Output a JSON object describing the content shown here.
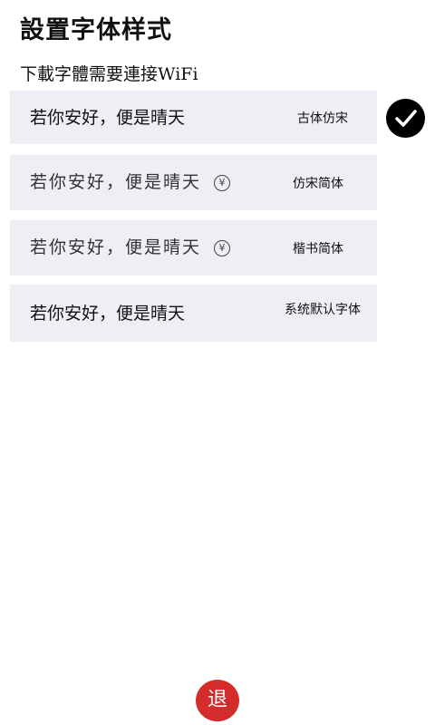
{
  "header": {
    "title": "設置字体样式",
    "subtitle": "下載字體需要連接WiFi"
  },
  "font_options": [
    {
      "sample": "若你安好，便是晴天",
      "name": "古体仿宋",
      "selected": true,
      "paid": false
    },
    {
      "sample": "若你安好，便是晴天",
      "name": "仿宋简体",
      "selected": false,
      "paid": true,
      "price_symbol": "¥"
    },
    {
      "sample": "若你安好，便是晴天",
      "name": "楷书简体",
      "selected": false,
      "paid": true,
      "price_symbol": "¥"
    },
    {
      "sample": "若你安好，便是晴天",
      "name": "系统默认字体",
      "selected": false,
      "paid": false
    }
  ],
  "selected_icon": "checkmark-icon",
  "paid_icon": "yen-coin-icon",
  "footer": {
    "back_label": "退"
  },
  "colors": {
    "row_background": "#efeef4",
    "selected_indicator": "#000000",
    "back_button": "#d42b2b"
  }
}
